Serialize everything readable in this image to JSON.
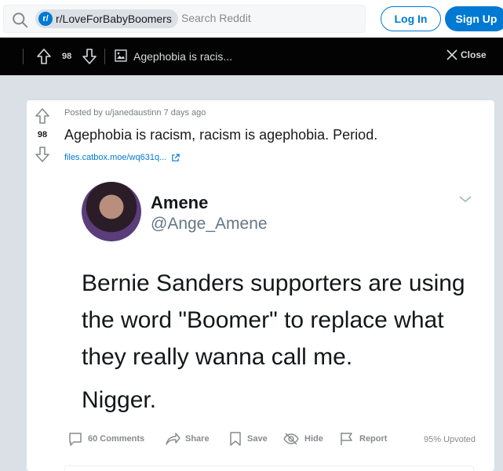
{
  "header": {
    "community_badge": "r/",
    "community_name": "r/LoveForBabyBoomers",
    "search_placeholder": "Search Reddit",
    "login_label": "Log In",
    "signup_label": "Sign Up"
  },
  "media_bar": {
    "score": "98",
    "title": "Agephobia is racis...",
    "close_label": "Close"
  },
  "post": {
    "score": "98",
    "meta": "Posted by u/janedaustinn 7 days ago",
    "title": "Agephobia is racism, racism is agephobia. Period.",
    "link": "files.catbox.moe/wq631q...",
    "tweet": {
      "name": "Amene",
      "handle": "@Ange_Amene",
      "text": "Bernie Sanders supporters are using the word \"Boomer\" to replace what they really wanna call me.",
      "text2": "Nigger."
    },
    "actions": {
      "comments": "60 Comments",
      "share": "Share",
      "save": "Save",
      "hide": "Hide",
      "report": "Report",
      "upvoted": "95% Upvoted"
    }
  },
  "colors": {
    "accent": "#0079d3",
    "page_bg": "#dae0e6",
    "media_bar_bg": "#030303"
  },
  "icons": [
    "search-icon",
    "upvote-icon",
    "downvote-icon",
    "image-icon",
    "close-icon",
    "external-link-icon",
    "chevron-down-icon",
    "comment-icon",
    "share-icon",
    "save-icon",
    "hide-icon",
    "report-icon"
  ]
}
